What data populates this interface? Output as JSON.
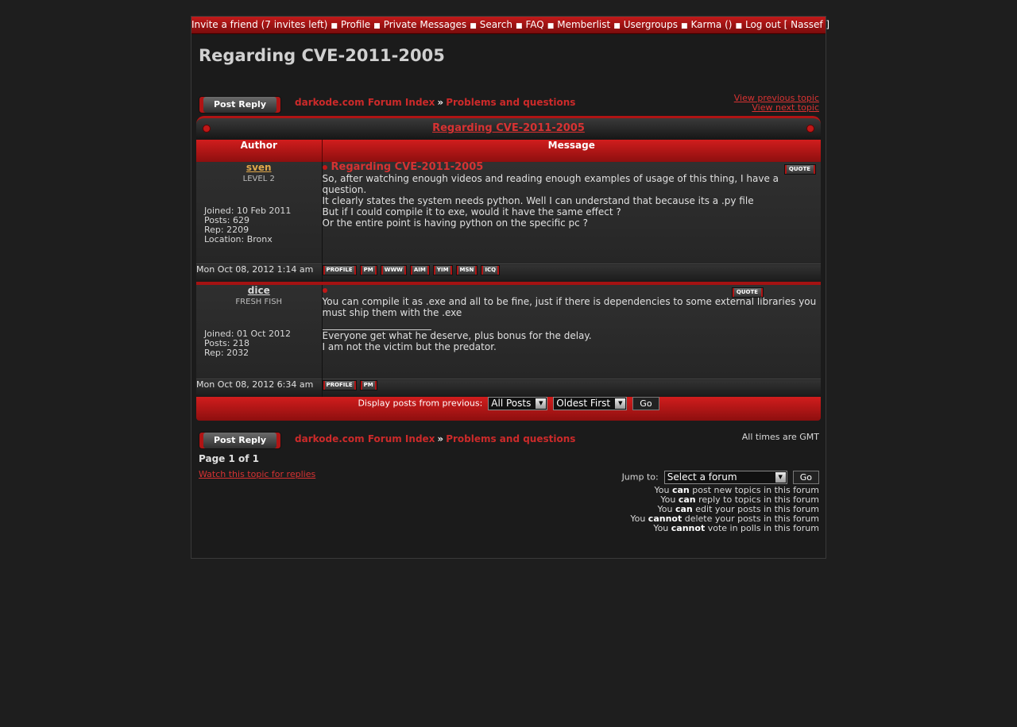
{
  "topnav": {
    "items": [
      "Invite a friend (7 invites left)",
      "Profile",
      "Private Messages",
      "Search",
      "FAQ",
      "Memberlist",
      "Usergroups",
      "Karma ()",
      "Log out [ Nassef ]"
    ],
    "separator": "■"
  },
  "page": {
    "title": "Regarding CVE-2011-2005",
    "post_reply": "Post Reply",
    "crumb_index": "darkode.com Forum Index",
    "crumb_sep": "»",
    "crumb_forum": "Problems and questions",
    "view_prev": "View previous topic",
    "view_next": "View next topic"
  },
  "table": {
    "caption": "Regarding CVE-2011-2005",
    "header_author": "Author",
    "header_message": "Message",
    "quote_label": "QUOTE"
  },
  "posts": [
    {
      "author": "sven",
      "rank": "LEVEL 2",
      "joined": "Joined: 10 Feb 2011",
      "posts": "Posts: 629",
      "rep": "Rep: 2209",
      "location": "Location: Bronx",
      "title": "Regarding CVE-2011-2005",
      "lines": [
        "So, after watching enough videos and reading enough examples of usage of this thing, I have a question.",
        "It clearly states the system needs python. Well I can understand that because its a .py file",
        "But if I could compile it to exe, would it have the same effect ?",
        "Or the entire point is having python on the specific pc ?"
      ],
      "date": "Mon Oct 08, 2012 1:14 am",
      "icons": [
        "PROFILE",
        "PM",
        "WWW",
        "AIM",
        "YIM",
        "MSN",
        "ICQ"
      ]
    },
    {
      "author": "dice",
      "rank": "FRESH FISH",
      "joined": "Joined: 01 Oct 2012",
      "posts": "Posts: 218",
      "rep": "Rep: 2032",
      "lines": [
        "You can compile it as .exe and all to be fine, just if there is dependencies to some external libraries you must ship them with the .exe"
      ],
      "signature": [
        "Everyone get what he deserve, plus bonus for the delay.",
        "I am not the victim but the predator."
      ],
      "date": "Mon Oct 08, 2012 6:34 am",
      "icons": [
        "PROFILE",
        "PM"
      ]
    }
  ],
  "footer": {
    "display_label": "Display posts from previous:",
    "range_value": "All Posts",
    "order_value": "Oldest First",
    "go": "Go",
    "gmt": "All times are GMT",
    "page_of": "Page 1 of 1",
    "watch": "Watch this topic for replies",
    "jump_label": "Jump to:",
    "jump_value": "Select a forum",
    "jump_go": "Go",
    "perms": [
      {
        "pre": "You ",
        "b": "can",
        "post": " post new topics in this forum"
      },
      {
        "pre": "You ",
        "b": "can",
        "post": " reply to topics in this forum"
      },
      {
        "pre": "You ",
        "b": "can",
        "post": " edit your posts in this forum"
      },
      {
        "pre": "You ",
        "b": "cannot",
        "post": " delete your posts in this forum"
      },
      {
        "pre": "You ",
        "b": "cannot",
        "post": " vote in polls in this forum"
      }
    ]
  }
}
